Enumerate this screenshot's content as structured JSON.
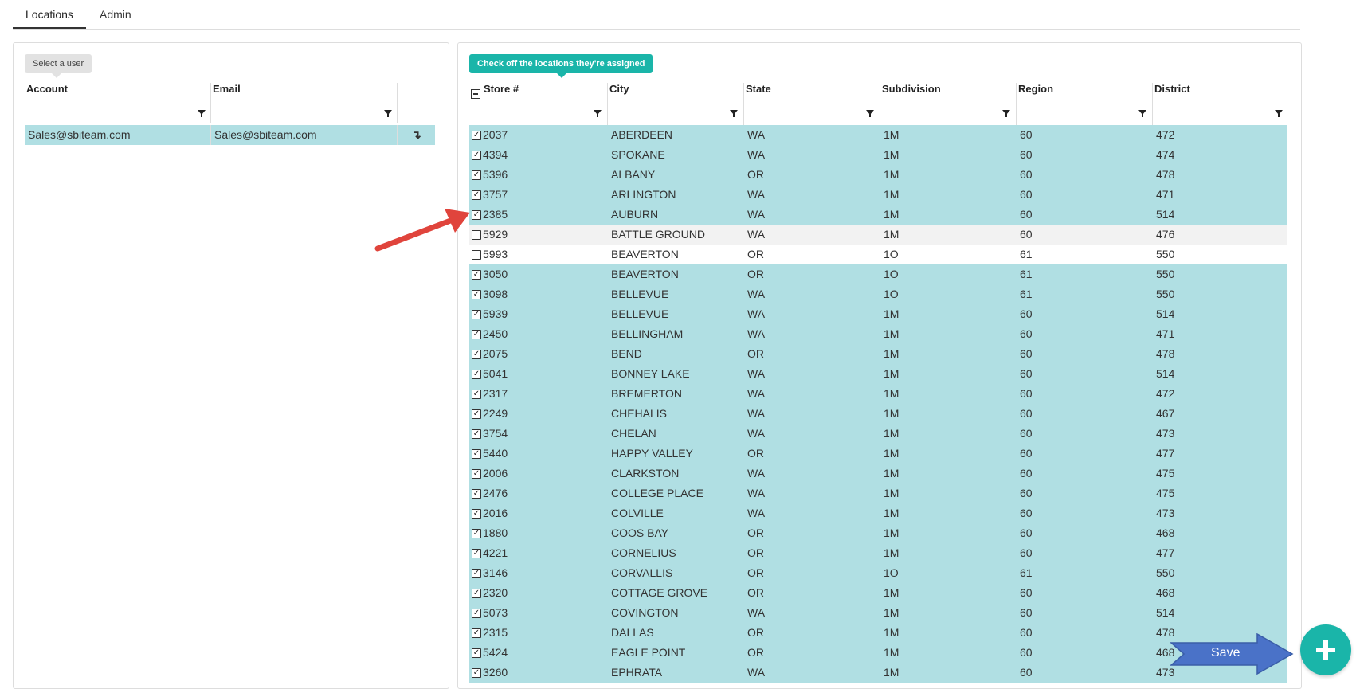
{
  "tabs": {
    "locations": "Locations",
    "admin": "Admin"
  },
  "left_panel": {
    "bubble": "Select a user",
    "headers": {
      "account": "Account",
      "email": "Email"
    },
    "user_row": {
      "account": "Sales@sbiteam.com",
      "email": "Sales@sbiteam.com",
      "action_glyph": "↴"
    }
  },
  "right_panel": {
    "bubble": "Check off the locations they're assigned",
    "headers": {
      "store": "Store #",
      "city": "City",
      "state": "State",
      "subdivision": "Subdivision",
      "region": "Region",
      "district": "District"
    },
    "rows": [
      {
        "checked": true,
        "store": "2037",
        "city": "ABERDEEN",
        "state": "WA",
        "subdivision": "1M",
        "region": "60",
        "district": "472"
      },
      {
        "checked": true,
        "store": "4394",
        "city": "SPOKANE",
        "state": "WA",
        "subdivision": "1M",
        "region": "60",
        "district": "474"
      },
      {
        "checked": true,
        "store": "5396",
        "city": "ALBANY",
        "state": "OR",
        "subdivision": "1M",
        "region": "60",
        "district": "478"
      },
      {
        "checked": true,
        "store": "3757",
        "city": "ARLINGTON",
        "state": "WA",
        "subdivision": "1M",
        "region": "60",
        "district": "471"
      },
      {
        "checked": true,
        "store": "2385",
        "city": "AUBURN",
        "state": "WA",
        "subdivision": "1M",
        "region": "60",
        "district": "514"
      },
      {
        "checked": false,
        "store": "5929",
        "city": "BATTLE GROUND",
        "state": "WA",
        "subdivision": "1M",
        "region": "60",
        "district": "476"
      },
      {
        "checked": false,
        "store": "5993",
        "city": "BEAVERTON",
        "state": "OR",
        "subdivision": "1O",
        "region": "61",
        "district": "550"
      },
      {
        "checked": true,
        "store": "3050",
        "city": "BEAVERTON",
        "state": "OR",
        "subdivision": "1O",
        "region": "61",
        "district": "550"
      },
      {
        "checked": true,
        "store": "3098",
        "city": "BELLEVUE",
        "state": "WA",
        "subdivision": "1O",
        "region": "61",
        "district": "550"
      },
      {
        "checked": true,
        "store": "5939",
        "city": "BELLEVUE",
        "state": "WA",
        "subdivision": "1M",
        "region": "60",
        "district": "514"
      },
      {
        "checked": true,
        "store": "2450",
        "city": "BELLINGHAM",
        "state": "WA",
        "subdivision": "1M",
        "region": "60",
        "district": "471"
      },
      {
        "checked": true,
        "store": "2075",
        "city": "BEND",
        "state": "OR",
        "subdivision": "1M",
        "region": "60",
        "district": "478"
      },
      {
        "checked": true,
        "store": "5041",
        "city": "BONNEY LAKE",
        "state": "WA",
        "subdivision": "1M",
        "region": "60",
        "district": "514"
      },
      {
        "checked": true,
        "store": "2317",
        "city": "BREMERTON",
        "state": "WA",
        "subdivision": "1M",
        "region": "60",
        "district": "472"
      },
      {
        "checked": true,
        "store": "2249",
        "city": "CHEHALIS",
        "state": "WA",
        "subdivision": "1M",
        "region": "60",
        "district": "467"
      },
      {
        "checked": true,
        "store": "3754",
        "city": "CHELAN",
        "state": "WA",
        "subdivision": "1M",
        "region": "60",
        "district": "473"
      },
      {
        "checked": true,
        "store": "5440",
        "city": "HAPPY VALLEY",
        "state": "OR",
        "subdivision": "1M",
        "region": "60",
        "district": "477"
      },
      {
        "checked": true,
        "store": "2006",
        "city": "CLARKSTON",
        "state": "WA",
        "subdivision": "1M",
        "region": "60",
        "district": "475"
      },
      {
        "checked": true,
        "store": "2476",
        "city": "COLLEGE PLACE",
        "state": "WA",
        "subdivision": "1M",
        "region": "60",
        "district": "475"
      },
      {
        "checked": true,
        "store": "2016",
        "city": "COLVILLE",
        "state": "WA",
        "subdivision": "1M",
        "region": "60",
        "district": "473"
      },
      {
        "checked": true,
        "store": "1880",
        "city": "COOS BAY",
        "state": "OR",
        "subdivision": "1M",
        "region": "60",
        "district": "468"
      },
      {
        "checked": true,
        "store": "4221",
        "city": "CORNELIUS",
        "state": "OR",
        "subdivision": "1M",
        "region": "60",
        "district": "477"
      },
      {
        "checked": true,
        "store": "3146",
        "city": "CORVALLIS",
        "state": "OR",
        "subdivision": "1O",
        "region": "61",
        "district": "550"
      },
      {
        "checked": true,
        "store": "2320",
        "city": "COTTAGE GROVE",
        "state": "OR",
        "subdivision": "1M",
        "region": "60",
        "district": "468"
      },
      {
        "checked": true,
        "store": "5073",
        "city": "COVINGTON",
        "state": "WA",
        "subdivision": "1M",
        "region": "60",
        "district": "514"
      },
      {
        "checked": true,
        "store": "2315",
        "city": "DALLAS",
        "state": "OR",
        "subdivision": "1M",
        "region": "60",
        "district": "478"
      },
      {
        "checked": true,
        "store": "5424",
        "city": "EAGLE POINT",
        "state": "OR",
        "subdivision": "1M",
        "region": "60",
        "district": "468"
      },
      {
        "checked": true,
        "store": "3260",
        "city": "EPHRATA",
        "state": "WA",
        "subdivision": "1M",
        "region": "60",
        "district": "473"
      }
    ]
  },
  "save_label": "Save",
  "fab_icon": "plus-icon",
  "colors": {
    "selected_row": "#b0dfe3",
    "accent": "#1ab5a9",
    "annotation_arrow": "#e0443c",
    "save_arrow": "#4a72c8"
  }
}
